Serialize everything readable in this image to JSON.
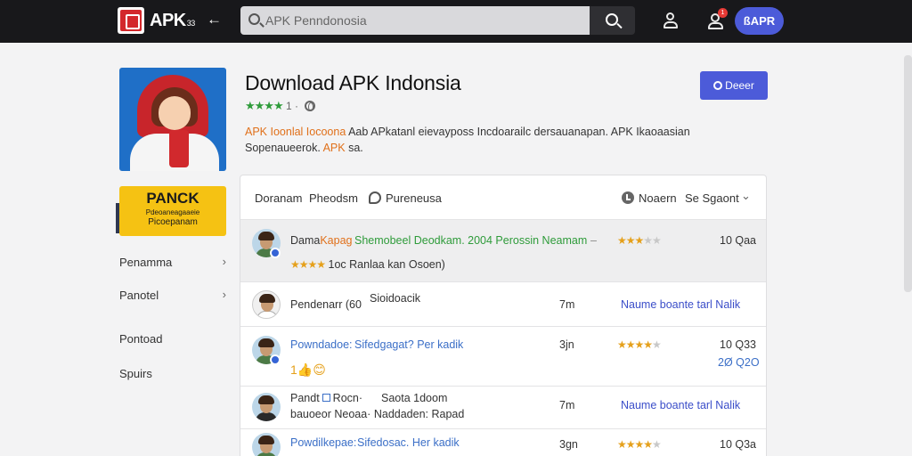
{
  "topbar": {
    "brand": "APK",
    "brand_suffix": "33",
    "back_icon": "←",
    "search_placeholder": "APK Penndonosia",
    "user_pill": "ßAPR",
    "notification_count": "1"
  },
  "app": {
    "title": "Download APK Indonsia",
    "stars": "★★★★",
    "rating_suffix": "1 ·",
    "description_hl1": "APK Ioonlal Iocoona",
    "description_mid": "Aab APkatanl eievayposs Incdoarailc dersauanapan. APK Ikaoaasian Sopenaueerok. ",
    "description_hl2": "APK",
    "description_end": "sa.",
    "download_label": "Deeer"
  },
  "promo": {
    "title": "PANCK",
    "line1": "Pdeoaneagaaeie",
    "line2": "Picoepanam"
  },
  "sidebar": {
    "items": [
      {
        "label": "Penamma",
        "chevron": "›"
      },
      {
        "label": "Panotel",
        "chevron": "›"
      },
      {
        "label": "Pontoad",
        "chevron": ""
      },
      {
        "label": "Spuirs",
        "chevron": ""
      }
    ]
  },
  "panel": {
    "header": {
      "col1": "Doranam",
      "col2": "Pheodsm",
      "col3": "Pureneusa",
      "col4": "Noaern",
      "col5": "Se Sgaont",
      "chevron": "⌄"
    },
    "rows": [
      {
        "name": "Dama",
        "name_accent": "Kapag",
        "title": "Shemobeel Deodkam. 2004 Perossin Neamam",
        "sub_stars": "★★★★",
        "sub_text": "1oc Ranlaa kan Osoen)",
        "dash": "–",
        "stars": "★★★",
        "stars_gray": "★★",
        "size": "10 Qaa"
      },
      {
        "name": "Pendenarr (60",
        "title": "Sioidoacik",
        "time": "7m",
        "link": "Naume boante tarl Nalik"
      },
      {
        "name": "Powndadoe:",
        "title": "Sifedgagat? Per kadik",
        "sub": "1👍😊",
        "time": "3jn",
        "stars": "★★★★",
        "stars_gray": "★",
        "size": "10 Q33",
        "extra": "2Ø Q2O"
      },
      {
        "name": "Pandt",
        "name2": "Rocn·",
        "title": "Saota 1doom",
        "sub_a": "bauoeor Neoaa·",
        "sub_b": "Naddaden: Rapad",
        "time": "7m",
        "link": "Naume boante tarl Nalik"
      },
      {
        "name": "Powdilkepae:",
        "title": "Sifedosac. Her kadik",
        "time": "3gn",
        "stars": "★★★★",
        "stars_gray": "★",
        "size": "10 Q3a"
      }
    ]
  }
}
